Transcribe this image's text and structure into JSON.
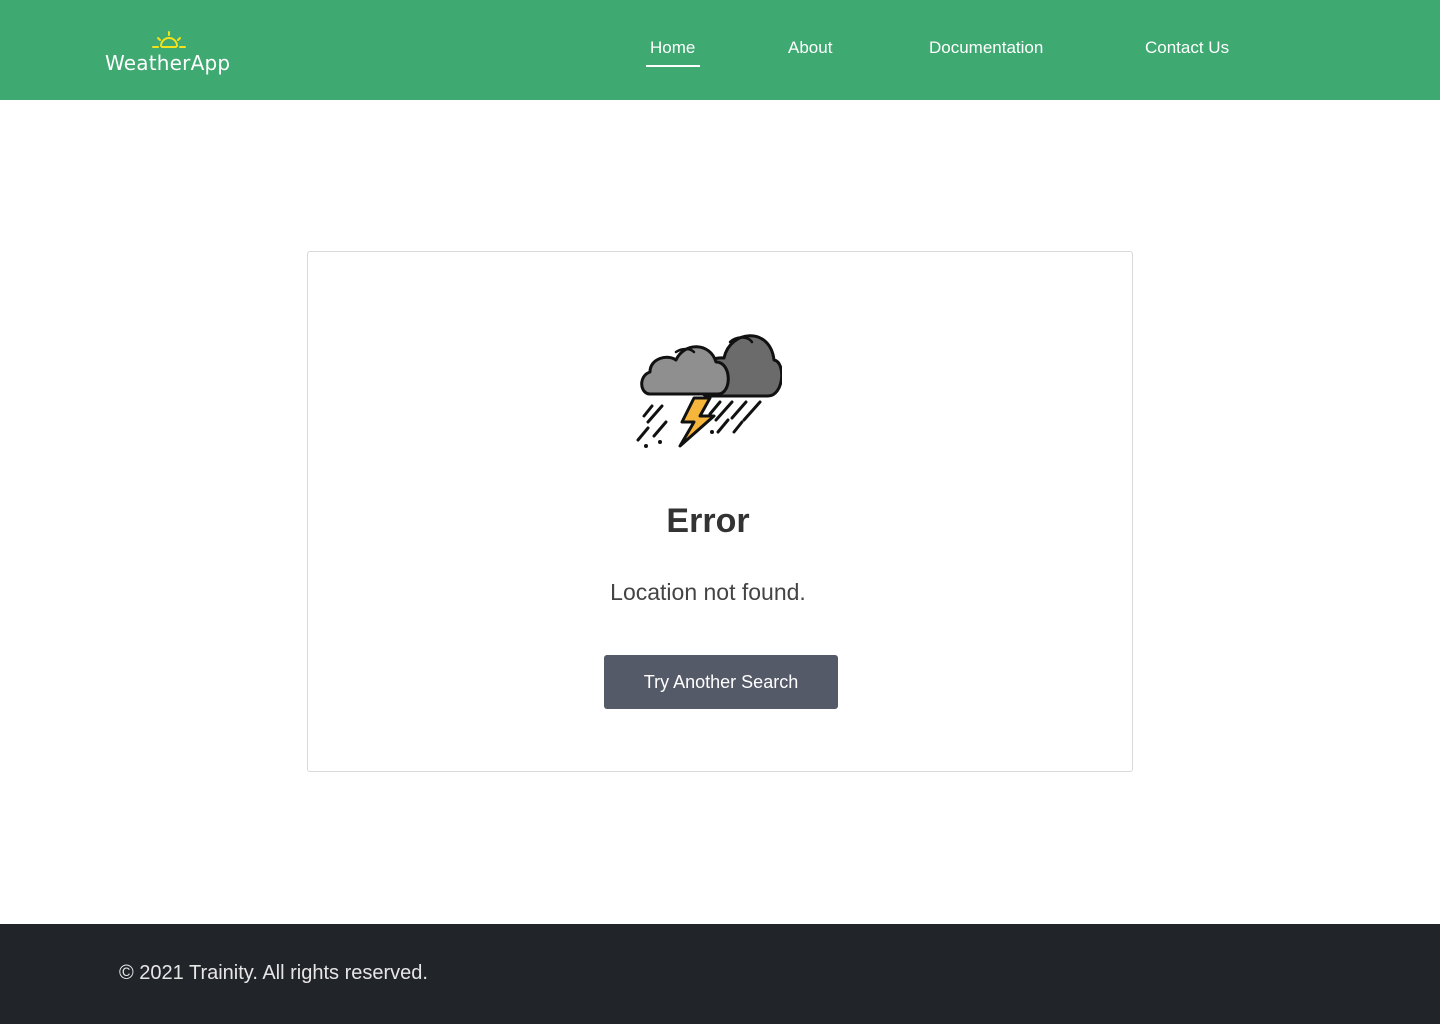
{
  "app": {
    "name": "WeatherApp",
    "logo_icon": "sunrise-icon",
    "accent_color": "#3ea971"
  },
  "nav": {
    "items": [
      {
        "label": "Home",
        "active": true
      },
      {
        "label": "About",
        "active": false
      },
      {
        "label": "Documentation",
        "active": false
      },
      {
        "label": "Contact Us",
        "active": false
      }
    ]
  },
  "error": {
    "icon": "thunderstorm-icon",
    "title": "Error",
    "message": "Location not found.",
    "button_label": "Try Another Search"
  },
  "footer": {
    "copyright": "© 2021 Trainity. All rights reserved."
  }
}
